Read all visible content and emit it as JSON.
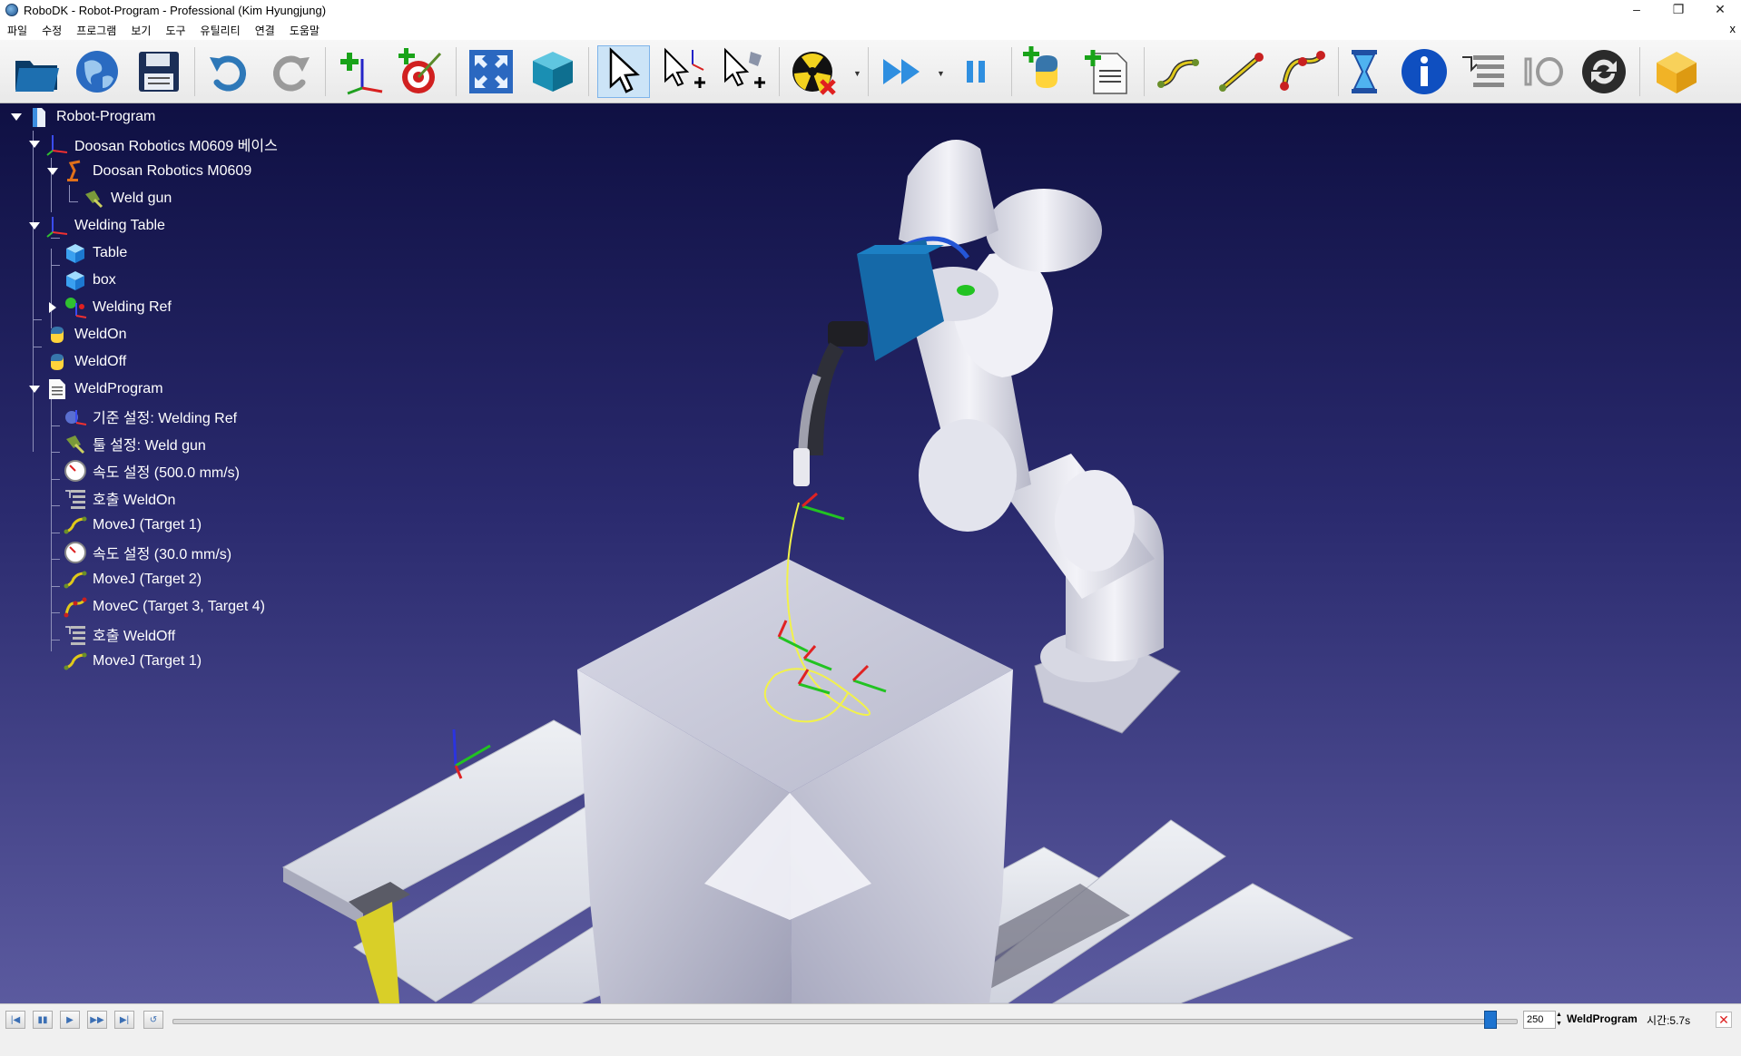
{
  "window": {
    "title": "RoboDK - Robot-Program - Professional (Kim Hyungjung)",
    "minimize": "–",
    "restore": "❐",
    "close": "✕",
    "menubar_close": "x"
  },
  "menu": [
    "파일",
    "수정",
    "프로그램",
    "보기",
    "도구",
    "유틸리티",
    "연결",
    "도움말"
  ],
  "toolbar": {
    "icons": [
      "open-folder-icon",
      "globe-icon",
      "save-icon",
      "undo-icon",
      "redo-icon",
      "add-reference-frame-icon",
      "add-target-icon",
      "fit-all-icon",
      "iso-view-cube-icon",
      "select-pointer-icon",
      "move-reference-icon",
      "move-tool-icon",
      "collision-check-icon",
      "fast-simulation-icon",
      "pause-icon",
      "add-python-program-icon",
      "add-program-icon",
      "movej-instruction-icon",
      "movel-instruction-icon",
      "movec-instruction-icon",
      "pause-instruction-icon",
      "info-icon",
      "program-call-icon",
      "io-instruction-icon",
      "update-icon",
      "package-icon"
    ],
    "selected": "select-pointer-icon"
  },
  "tree": {
    "root": "Robot-Program",
    "items": [
      {
        "label": "Robot-Program",
        "icon": "station-icon"
      },
      {
        "label": "Doosan Robotics M0609 베이스",
        "icon": "frame-icon"
      },
      {
        "label": "Doosan Robotics M0609",
        "icon": "robot-icon"
      },
      {
        "label": "Weld gun",
        "icon": "weld-gun-icon"
      },
      {
        "label": "Welding Table",
        "icon": "frame-icon"
      },
      {
        "label": "Table",
        "icon": "object-cube-icon"
      },
      {
        "label": "box",
        "icon": "object-cube-icon"
      },
      {
        "label": "Welding Ref",
        "icon": "reference-targets-icon"
      },
      {
        "label": "WeldOn",
        "icon": "python-icon"
      },
      {
        "label": "WeldOff",
        "icon": "python-icon"
      },
      {
        "label": "WeldProgram",
        "icon": "program-icon"
      },
      {
        "label": "기준 설정: Welding Ref",
        "icon": "set-reference-icon"
      },
      {
        "label": "툴 설정: Weld gun",
        "icon": "set-tool-icon"
      },
      {
        "label": "속도 설정 (500.0 mm/s)",
        "icon": "speed-icon"
      },
      {
        "label": "호출 WeldOn",
        "icon": "call-icon"
      },
      {
        "label": "MoveJ (Target 1)",
        "icon": "movej-icon"
      },
      {
        "label": "속도 설정 (30.0 mm/s)",
        "icon": "speed-icon"
      },
      {
        "label": "MoveJ (Target 2)",
        "icon": "movej-icon"
      },
      {
        "label": "MoveC (Target 3, Target 4)",
        "icon": "movec-icon"
      },
      {
        "label": "호출 WeldOff",
        "icon": "call-icon"
      },
      {
        "label": "MoveJ (Target 1)",
        "icon": "movej-icon"
      }
    ]
  },
  "playback": {
    "buttons": [
      "first-icon",
      "pause-icon",
      "play-icon",
      "fast-forward-icon",
      "last-icon",
      "loop-icon"
    ],
    "progress": 0.98,
    "speed_value": "250",
    "program_name": "WeldProgram",
    "time_label": "시간:5.7s",
    "stop_label": "✕"
  },
  "colors": {
    "viewport_top": "#0f1043",
    "viewport_bottom": "#5b5a9f",
    "selection": "#cce4f7",
    "path": "#f2f24a"
  }
}
